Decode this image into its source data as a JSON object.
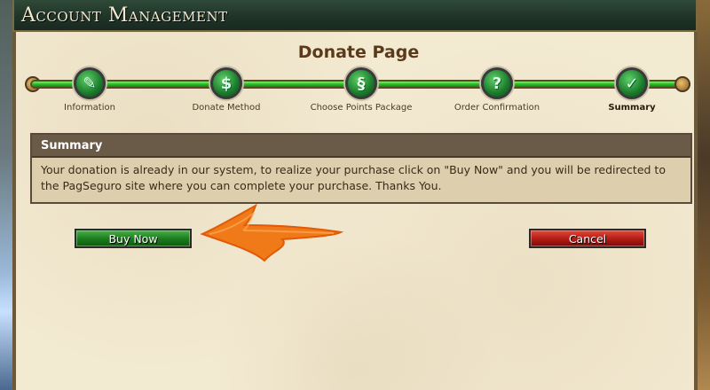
{
  "window": {
    "title": "Account Management"
  },
  "page": {
    "title": "Donate Page"
  },
  "steps": [
    {
      "label": "Information",
      "icon": "feather-icon",
      "glyph": "✎",
      "active": false
    },
    {
      "label": "Donate Method",
      "icon": "coin-icon",
      "glyph": "$",
      "active": false
    },
    {
      "label": "Choose Points Package",
      "icon": "scroll-icon",
      "glyph": "§",
      "active": false
    },
    {
      "label": "Order Confirmation",
      "icon": "question-icon",
      "glyph": "?",
      "active": false
    },
    {
      "label": "Summary",
      "icon": "check-icon",
      "glyph": "✓",
      "active": true
    }
  ],
  "summary": {
    "heading": "Summary",
    "text": "Your donation is already in our system, to realize your purchase click on \"Buy Now\" and you will be redirected to the PagSeguro site where you can complete your purchase. Thanks You."
  },
  "buttons": {
    "buy_now": "Buy Now",
    "cancel": "Cancel"
  },
  "colors": {
    "accent_green": "#1a7a1a",
    "cancel_red": "#b01a14",
    "arrow_orange": "#f07a18",
    "parchment": "#f3ead2"
  }
}
